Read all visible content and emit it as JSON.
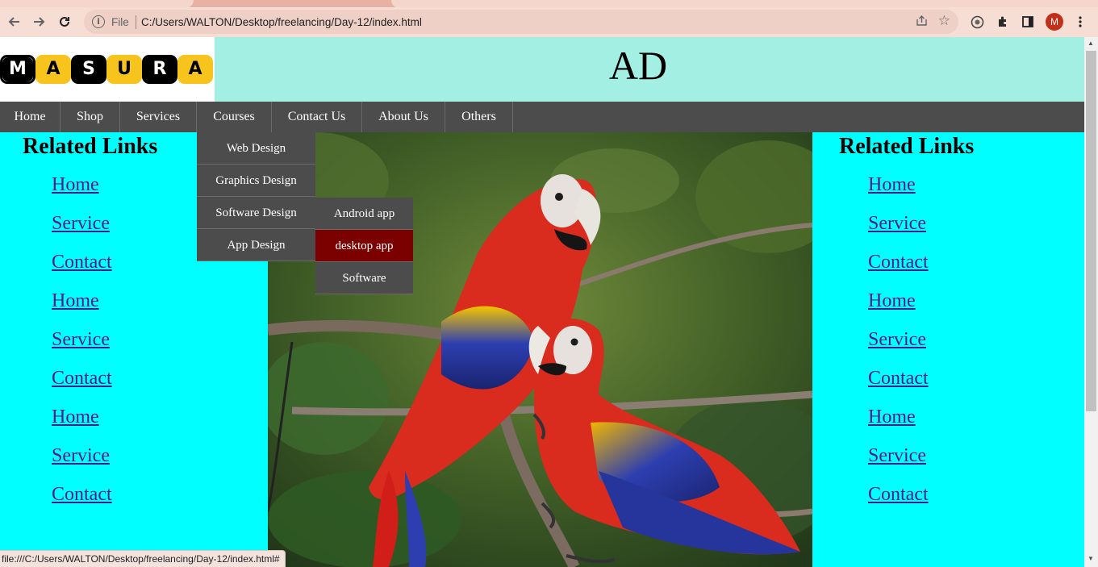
{
  "browser": {
    "scheme_label": "File",
    "url": "C:/Users/WALTON/Desktop/freelancing/Day-12/index.html",
    "profile_initial": "M",
    "status_url": "file:///C:/Users/WALTON/Desktop/freelancing/Day-12/index.html#"
  },
  "header": {
    "logo_letters": [
      "M",
      "A",
      "S",
      "U",
      "R",
      "A"
    ],
    "ad_text": "AD"
  },
  "nav": {
    "items": [
      "Home",
      "Shop",
      "Services",
      "Courses",
      "Contact Us",
      "About Us",
      "Others"
    ]
  },
  "courses_menu": {
    "items": [
      "Web Design",
      "Graphics Design",
      "Software Design",
      "App Design"
    ]
  },
  "software_submenu": {
    "items": [
      "Android app",
      "desktop app",
      "Software"
    ],
    "active_index": 1
  },
  "left_sidebar": {
    "title": "Related Links",
    "links": [
      "Home",
      "Service",
      "Contact",
      "Home",
      "Service",
      "Contact",
      "Home",
      "Service",
      "Contact"
    ]
  },
  "right_sidebar": {
    "title": "Related Links",
    "links": [
      "Home",
      "Service",
      "Contact",
      "Home",
      "Service",
      "Contact",
      "Home",
      "Service",
      "Contact"
    ]
  },
  "colors": {
    "sidebar_bg": "#00ffff",
    "ad_bg": "#a4efe4",
    "nav_bg": "#4c4c4c",
    "active_menu_bg": "#7b0000",
    "logo_yellow": "#f7c31d",
    "logo_black": "#000000"
  }
}
